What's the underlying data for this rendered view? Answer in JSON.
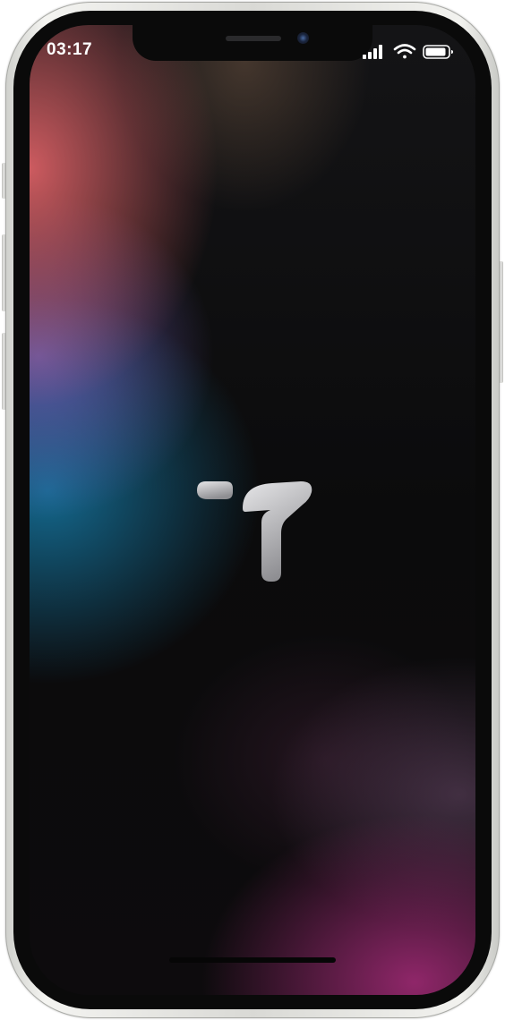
{
  "status_bar": {
    "time": "03:17",
    "icons": [
      "cellular-signal-icon",
      "wifi-icon",
      "battery-icon"
    ]
  },
  "app": {
    "logo": "app-logo-icon"
  },
  "colors": {
    "logo_gradient_start": "#e6e6e8",
    "logo_gradient_end": "#8e8e92",
    "background_accent_top_left": "#d75f64",
    "background_accent_mid_left": "#146e96",
    "background_accent_bottom_right": "#96286e"
  }
}
